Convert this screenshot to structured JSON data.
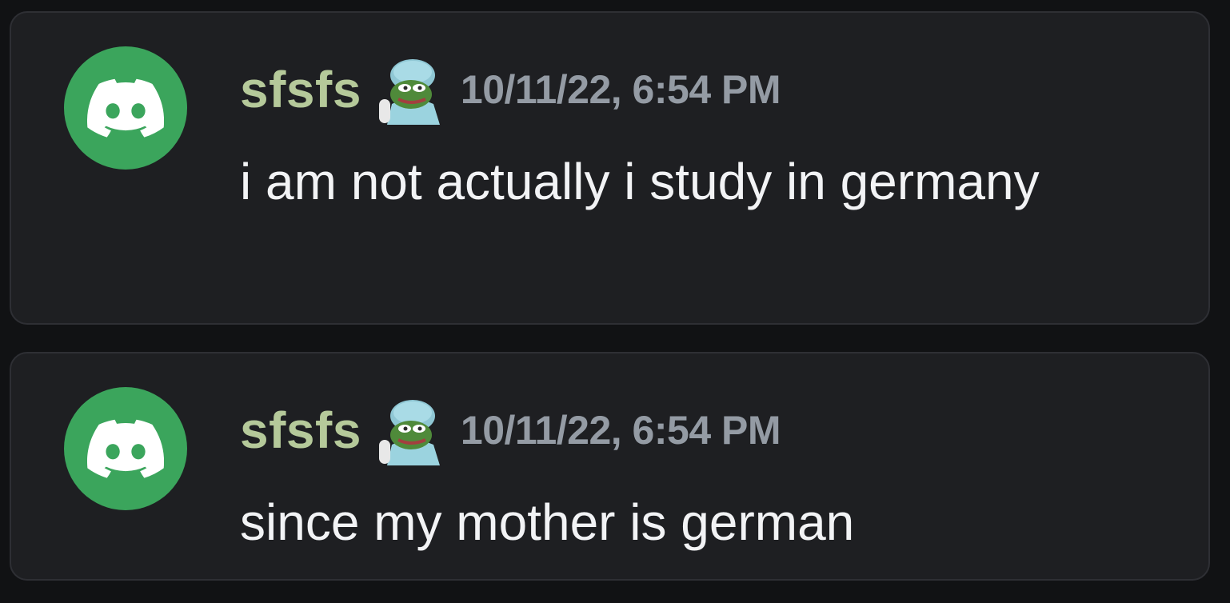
{
  "messages": [
    {
      "author": "sfsfs",
      "timestamp": "10/11/22, 6:54 PM",
      "content": "i am not actually i study in germany",
      "avatar_icon": "discord-logo-icon",
      "role_icon": "pepe-doctor-icon"
    },
    {
      "author": "sfsfs",
      "timestamp": "10/11/22, 6:54 PM",
      "content": "since my mother is german",
      "avatar_icon": "discord-logo-icon",
      "role_icon": "pepe-doctor-icon"
    }
  ],
  "colors": {
    "background": "#111214",
    "card": "#1e1f22",
    "card_border": "#2e2f34",
    "avatar": "#3ba55c",
    "username": "#b5c99a",
    "timestamp": "#949ba4",
    "text": "#f2f3f5"
  }
}
